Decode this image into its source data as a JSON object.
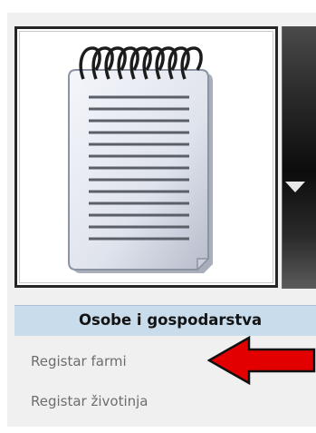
{
  "tile": {
    "icon": "notepad-icon"
  },
  "dropdown": {
    "icon": "dropdown-arrow-icon"
  },
  "section": {
    "title": "Osobe i gospodarstva",
    "items": [
      {
        "label": "Registar farmi"
      },
      {
        "label": "Registar životinja"
      }
    ]
  },
  "annotation": {
    "icon": "red-arrow-icon",
    "color": "#e30000"
  },
  "colors": {
    "header_bg": "#c9dceb",
    "item_text": "#6d6d6d",
    "tile_border": "#262626"
  }
}
